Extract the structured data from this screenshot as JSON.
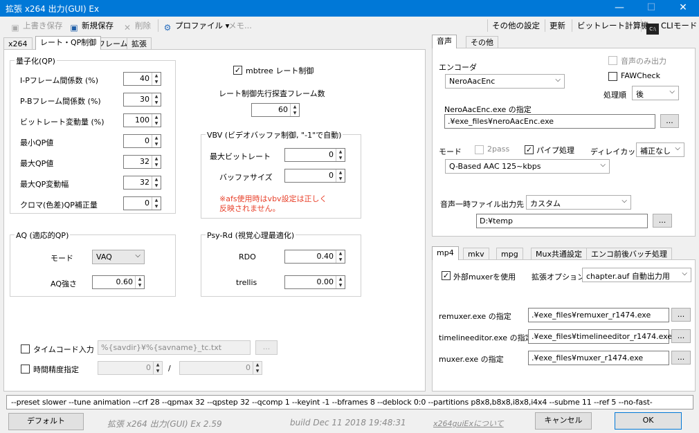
{
  "window": {
    "title": "拡張 x264 出力(GUI) Ex",
    "minimize": "—",
    "maximize": "☐",
    "close": "✕"
  },
  "toolbar": {
    "overwrite": "上書き保存",
    "save_new": "新規保存",
    "delete": "削除",
    "profile": "プロファイル",
    "profile_arrow": "▾",
    "memo": "メモ...",
    "other_settings": "その他の設定",
    "refresh": "更新",
    "bitrate_calc": "ビットレート計算機",
    "cli_mode": "CLIモード"
  },
  "main_tabs": [
    "x264",
    "レート・QP制御",
    "フレーム",
    "拡張"
  ],
  "quant": {
    "title": "量子化(QP)",
    "rows": [
      {
        "label": "I-Pフレーム間係数 (%)",
        "value": "40"
      },
      {
        "label": "P-Bフレーム間係数 (%)",
        "value": "30"
      },
      {
        "label": "ビットレート変動量 (%)",
        "value": "100"
      },
      {
        "label": "最小QP値",
        "value": "0"
      },
      {
        "label": "最大QP値",
        "value": "32"
      },
      {
        "label": "最大QP変動幅",
        "value": "32"
      },
      {
        "label": "クロマ(色差)QP補正量",
        "value": "0"
      }
    ]
  },
  "mbtree": {
    "label": "mbtree レート制御",
    "checked": "✓",
    "lookahead_label": "レート制御先行探査フレーム数",
    "lookahead_value": "60"
  },
  "vbv": {
    "title": "VBV (ビデオバッファ制御, \"-1\"で自動)",
    "maxrate_label": "最大ビットレート",
    "maxrate_value": "0",
    "bufsize_label": "バッファサイズ",
    "bufsize_value": "0",
    "warning_line1": "※afs使用時はvbv設定は正しく",
    "warning_line2": "反映されません。"
  },
  "aq": {
    "title": "AQ (適応的QP)",
    "mode_label": "モード",
    "mode_value": "VAQ",
    "strength_label": "AQ強さ",
    "strength_value": "0.60"
  },
  "psy": {
    "title": "Psy-Rd (視覚心理最適化)",
    "rdo_label": "RDO",
    "rdo_value": "0.40",
    "trellis_label": "trellis",
    "trellis_value": "0.00"
  },
  "timecode": {
    "label": "タイムコード入力",
    "value": "%{savdir}¥%{savname}_tc.txt",
    "browse": "..."
  },
  "timescale": {
    "label": "時間精度指定",
    "value1": "0",
    "sep": "/",
    "value2": "0"
  },
  "audio_tabs": [
    "音声",
    "その他"
  ],
  "audio": {
    "encoder_label": "エンコーダ",
    "encoder_value": "NeroAacEnc",
    "audio_only_label": "音声のみ出力",
    "faw_label": "FAWCheck",
    "order_label": "処理順",
    "order_value": "後",
    "exe_label": "NeroAacEnc.exe の指定",
    "exe_path": ".¥exe_files¥neroAacEnc.exe",
    "browse": "...",
    "mode_label": "モード",
    "twopass_label": "2pass",
    "pipe_label": "パイプ処理",
    "pipe_checked": "✓",
    "delay_label": "ディレイカット",
    "delay_value": "補正なし",
    "quality_value": "Q-Based AAC 125~kbps",
    "temp_label": "音声一時ファイル出力先",
    "temp_value": "カスタム",
    "temp_path": "D:¥temp"
  },
  "mux_tabs": [
    "mp4",
    "mkv",
    "mpg",
    "Mux共通設定",
    "エンコ前後バッチ処理"
  ],
  "mux": {
    "use_external_label": "外部muxerを使用",
    "use_external_checked": "✓",
    "ext_option_label": "拡張オプション",
    "ext_option_value": "chapter.auf 自動出力用",
    "remuxer_label": "remuxer.exe の指定",
    "remuxer_path": ".¥exe_files¥remuxer_r1474.exe",
    "timelineeditor_label": "timelineeditor.exe の指定",
    "timelineeditor_path": ".¥exe_files¥timelineeditor_r1474.exe",
    "muxer_label": "muxer.exe の指定",
    "muxer_path": ".¥exe_files¥muxer_r1474.exe",
    "browse": "..."
  },
  "cmdline": "--preset slower --tune animation --crf 28 --qpmax 32 --qpstep 32 --qcomp 1 --keyint -1 --bframes 8 --deblock 0:0 --partitions p8x8,b8x8,i8x8,i4x4 --subme 11 --ref 5 --no-fast-",
  "footer": {
    "default_button": "デフォルト",
    "app_version": "拡張 x264 出力(GUI) Ex 2.59",
    "build": "build Dec 11 2018 19:48:31",
    "about_link": "x264guiExについて",
    "cancel_button": "キャンセル",
    "ok_button": "OK"
  },
  "colors": {
    "titlebar": "#0078d7",
    "warning": "#e8402a"
  }
}
